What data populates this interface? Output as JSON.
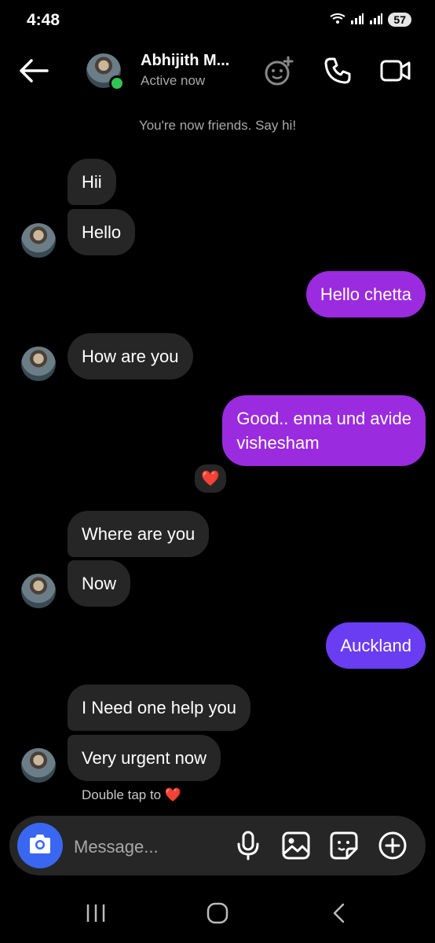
{
  "status": {
    "time": "4:48",
    "battery": "57"
  },
  "header": {
    "name": "Abhijith M...",
    "status": "Active now"
  },
  "system_message": "You're now friends. Say hi!",
  "messages": [
    {
      "text": "Hii"
    },
    {
      "text": "Hello"
    },
    {
      "text": "Hello chetta"
    },
    {
      "text": "How are you"
    },
    {
      "text": "Good.. enna und avide\nvishesham",
      "reaction": "❤️"
    },
    {
      "text": "Where are you"
    },
    {
      "text": "Now"
    },
    {
      "text": "Auckland"
    },
    {
      "text": "I Need one help you"
    },
    {
      "text": "Very urgent now"
    }
  ],
  "hint": "Double tap to ❤️",
  "composer": {
    "placeholder": "Message..."
  },
  "icons": {
    "header": [
      "back-arrow-icon",
      "avatar",
      "effects-icon",
      "phone-icon",
      "video-icon"
    ],
    "composer": [
      "camera-icon",
      "microphone-icon",
      "gallery-icon",
      "sticker-icon",
      "plus-icon"
    ],
    "nav": [
      "recent-apps-icon",
      "home-icon",
      "back-icon"
    ]
  },
  "colors": {
    "outgoing": "#9b2bdf",
    "outgoing_alt": "#6a3cf2",
    "incoming": "#262626",
    "camera": "#3a67f2",
    "online": "#31c552"
  }
}
